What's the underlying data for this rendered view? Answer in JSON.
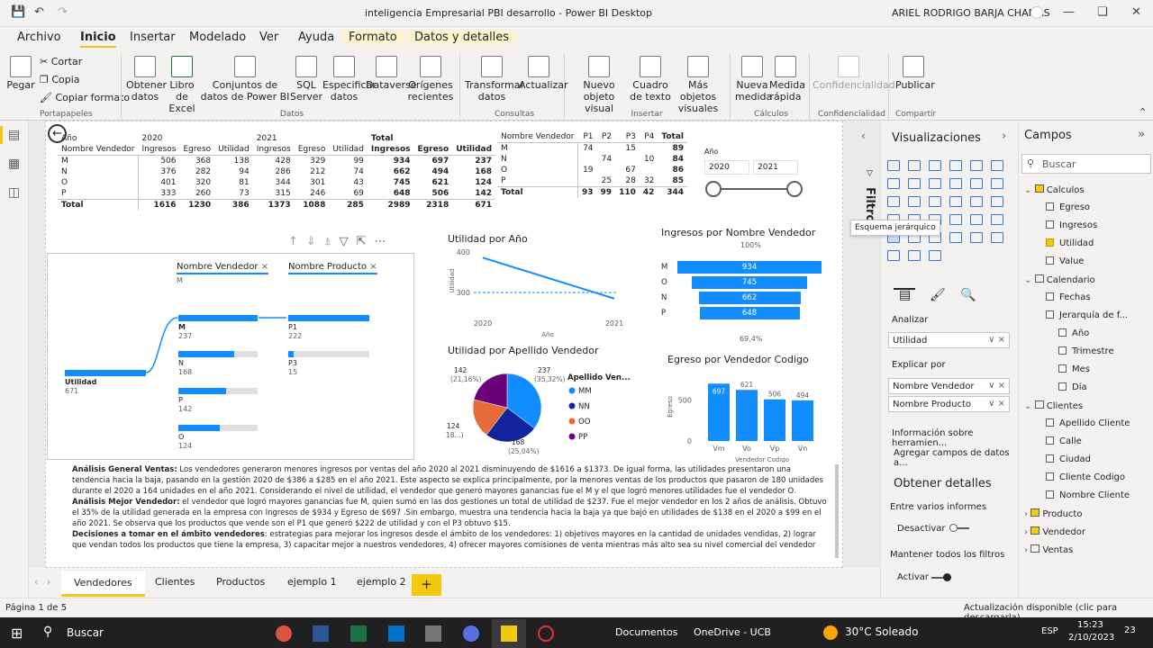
{
  "titlebar": {
    "title": "inteligencia Empresarial PBI desarrollo - Power BI Desktop",
    "user": "ARIEL RODRIGO BARJA CHAMAS"
  },
  "menu": [
    "Archivo",
    "Inicio",
    "Insertar",
    "Modelado",
    "Ver",
    "Ayuda",
    "Formato",
    "Datos y detalles"
  ],
  "ribbon": {
    "pegar": "Pegar",
    "cortar": "Cortar",
    "copia": "Copia",
    "copiar_formato": "Copiar formato",
    "obtener": "Obtener datos",
    "libro": "Libro de Excel",
    "conjuntos": "Conjuntos de datos de Power BI",
    "sql": "SQL Server",
    "especificar": "Especificar datos",
    "dataverse": "Dataverse",
    "origenes": "Orígenes recientes",
    "transformar": "Transformar datos",
    "actualizar": "Actualizar",
    "nuevo_visual": "Nuevo objeto visual",
    "cuadro_texto": "Cuadro de texto",
    "mas_objetos": "Más objetos visuales",
    "nueva_medida": "Nueva medida",
    "medida_rapida": "Medida rápida",
    "confidencialidad": "Confidencialidad",
    "publicar": "Publicar",
    "groups": {
      "portapapeles": "Portapapeles",
      "datos": "Datos",
      "consultas": "Consultas",
      "insertar": "Insertar",
      "calculos": "Cálculos",
      "confidencialidad": "Confidencialidad",
      "compartir": "Compartir"
    }
  },
  "table1": {
    "year_label": "Año",
    "vendor_header": "Nombre Vendedor",
    "y2020": "2020",
    "y2021": "2021",
    "total": "Total",
    "sub": [
      "Ingresos",
      "Egreso",
      "Utilidad",
      "Ingresos",
      "Egreso",
      "Utilidad",
      "Ingresos",
      "Egreso",
      "Utilidad"
    ],
    "rows": [
      [
        "M",
        "506",
        "368",
        "138",
        "428",
        "329",
        "99",
        "934",
        "697",
        "237"
      ],
      [
        "N",
        "376",
        "282",
        "94",
        "286",
        "212",
        "74",
        "662",
        "494",
        "168"
      ],
      [
        "O",
        "401",
        "320",
        "81",
        "344",
        "301",
        "43",
        "745",
        "621",
        "124"
      ],
      [
        "P",
        "333",
        "260",
        "73",
        "315",
        "246",
        "69",
        "648",
        "506",
        "142"
      ],
      [
        "Total",
        "1616",
        "1230",
        "386",
        "1373",
        "1088",
        "285",
        "2989",
        "2318",
        "671"
      ]
    ]
  },
  "table2": {
    "headers": [
      "Nombre Vendedor",
      "P1",
      "P2",
      "P3",
      "P4",
      "Total"
    ],
    "rows": [
      [
        "M",
        "74",
        "",
        "15",
        "",
        "89"
      ],
      [
        "N",
        "",
        "74",
        "",
        "10",
        "84"
      ],
      [
        "O",
        "19",
        "",
        "67",
        "",
        "86"
      ],
      [
        "P",
        "",
        "25",
        "28",
        "32",
        "85"
      ],
      [
        "Total",
        "93",
        "99",
        "110",
        "42",
        "344"
      ]
    ]
  },
  "slicer": {
    "label": "Año",
    "from": "2020",
    "to": "2021"
  },
  "decomp": {
    "chip1": "Nombre Vendedor",
    "chip2": "Nombre Producto",
    "chip1_sub": "M",
    "root_label": "Utilidad",
    "root_value": "671",
    "level1": [
      {
        "label": "M",
        "value": "237",
        "frac": 1
      },
      {
        "label": "N",
        "value": "168",
        "frac": 0.709
      },
      {
        "label": "P",
        "value": "142",
        "frac": 0.599
      },
      {
        "label": "O",
        "value": "124",
        "frac": 0.523
      }
    ],
    "level2": [
      {
        "label": "P1",
        "value": "222",
        "frac": 1
      },
      {
        "label": "P3",
        "value": "15",
        "frac": 0.068
      }
    ]
  },
  "line_chart": {
    "title": "Utilidad por Año",
    "ylabel": "Utilidad",
    "xlabel": "Año",
    "chart_data": {
      "type": "line",
      "x": [
        "2020",
        "2021"
      ],
      "y": [
        386,
        285
      ],
      "yticks": [
        "400",
        "300"
      ],
      "ylim": [
        280,
        400
      ]
    }
  },
  "pie_chart": {
    "title": "Utilidad por Apellido Vendedor",
    "legend_title": "Apellido Ven...",
    "chart_data": {
      "type": "pie",
      "labels": [
        "MM",
        "NN",
        "OO",
        "PP"
      ],
      "values": [
        237,
        168,
        124,
        142
      ],
      "colors": [
        "#118dff",
        "#12239e",
        "#e66c37",
        "#6b007b"
      ],
      "data_labels": [
        "237 (35,32%)",
        "168 (25,04%)",
        "124 (18...)",
        "142 (21,16%)"
      ]
    }
  },
  "funnel": {
    "title": "Ingresos por Nombre Vendedor",
    "top": "100%",
    "bottom": "69,4%",
    "chart_data": {
      "type": "bar",
      "categories": [
        "M",
        "O",
        "N",
        "P"
      ],
      "values": [
        934,
        745,
        662,
        648
      ]
    }
  },
  "column_chart": {
    "title": "Egreso por Vendedor Codigo",
    "ylabel": "Egreso",
    "xlabel": "Vendedor Codigo",
    "yticks": [
      "500",
      "0"
    ],
    "chart_data": {
      "type": "bar",
      "categories": [
        "Vm",
        "Vo",
        "Vp",
        "Vn"
      ],
      "values": [
        697,
        621,
        506,
        494
      ],
      "ylim": [
        0,
        700
      ]
    }
  },
  "analysis": {
    "p1_title": "Análisis General Ventas:",
    "p1": " Los vendedores generaron menores ingresos por ventas del año 2020 al 2021 disminuyendo de $1616 a $1373. De igual forma, las utilidades presentaron una tendencia hacia la baja, pasando en la gestión 2020 de $386 a $285 en el año 2021. Este aspecto se explica principalmente, por la menores ventas de los productos que pasaron de 180 unidades durante el 2020 a 164 unidades en el año 2021. Considerando el nivel de utilidad, el vendedor que generó mayores ganancias fue el M y el que logró menores utilidades fue el vendedor O.",
    "p2_title": "Análisis Mejor Vendedor:",
    "p2": " el vendedor que logró mayores ganancias fue M, quien sumó en las dos gestiones un total de utilidad de $237. Fue el mejor vendedor en los 2 años de análisis. Obtuvo el 35% de la utilidad generada en la empresa con Ingresos de $934 y Egreso de $697 .Sin embargo, muestra una tendencia hacia la baja ya que bajó en utilidades de $138 en el 2020 a $99 en el año 2021. Se observa que los productos que vende son el P1 que generó $222 de utilidad y con el P3 obtuvo $15.",
    "p3_title": "Decisiones a tomar en el ámbito vendedores",
    "p3": ": estrategias para mejorar los ingresos desde el ámbito de los vendedores: 1) objetivos mayores en la cantidad de unidades vendidas, 2) lograr que vendan todos los productos que tiene la empresa, 3) capacitar mejor a nuestros vendedores, 4) ofrecer mayores comisiones de venta mientras más alto sea su nivel comercial del vendedor"
  },
  "pages": [
    "Vendedores",
    "Clientes",
    "Productos",
    "ejemplo 1",
    "ejemplo 2",
    "+"
  ],
  "status": {
    "page": "Página 1 de 5",
    "update": "Actualización disponible (clic para descargarla)"
  },
  "filters_label": "Filtros",
  "vis": {
    "title": "Visualizaciones",
    "tooltip": "Esquema jerárquico",
    "analizar": "Analizar",
    "analizar_val": "Utilidad",
    "explicar": "Explicar por",
    "explicar_vals": [
      "Nombre Vendedor",
      "Nombre Producto"
    ],
    "info": "Información sobre herramien...",
    "agregar": "Agregar campos de datos a...",
    "obtener": "Obtener detalles",
    "entre": "Entre varios informes",
    "desactivar": "Desactivar",
    "mantener": "Mantener todos los filtros",
    "activar": "Activar"
  },
  "campos": {
    "title": "Campos",
    "search": "Buscar",
    "items": [
      {
        "t": "Calculos",
        "lvl": 0,
        "kind": "table"
      },
      {
        "t": "Egreso",
        "lvl": 1,
        "kind": "field",
        "on": false
      },
      {
        "t": "Ingresos",
        "lvl": 1,
        "kind": "field",
        "on": false
      },
      {
        "t": "Utilidad",
        "lvl": 1,
        "kind": "field",
        "on": true
      },
      {
        "t": "Value",
        "lvl": 1,
        "kind": "field",
        "on": false
      },
      {
        "t": "Calendario",
        "lvl": 0,
        "kind": "table"
      },
      {
        "t": "Fechas",
        "lvl": 1,
        "kind": "field",
        "on": false
      },
      {
        "t": "Jerarquía de f...",
        "lvl": 2,
        "kind": "field",
        "on": false
      },
      {
        "t": "Año",
        "lvl": 3,
        "kind": "field",
        "on": false
      },
      {
        "t": "Trimestre",
        "lvl": 3,
        "kind": "field",
        "on": false
      },
      {
        "t": "Mes",
        "lvl": 3,
        "kind": "field",
        "on": false
      },
      {
        "t": "Día",
        "lvl": 3,
        "kind": "field",
        "on": false
      },
      {
        "t": "Clientes",
        "lvl": 0,
        "kind": "table"
      },
      {
        "t": "Apellido Cliente",
        "lvl": 1,
        "kind": "field",
        "on": false
      },
      {
        "t": "Calle",
        "lvl": 1,
        "kind": "field",
        "on": false
      },
      {
        "t": "Ciudad",
        "lvl": 1,
        "kind": "field",
        "on": false
      },
      {
        "t": "Cliente Codigo",
        "lvl": 1,
        "kind": "field",
        "on": false
      },
      {
        "t": "Nombre Cliente",
        "lvl": 1,
        "kind": "field",
        "on": false
      },
      {
        "t": "Producto",
        "lvl": 0,
        "kind": "table"
      },
      {
        "t": "Vendedor",
        "lvl": 0,
        "kind": "table"
      },
      {
        "t": "Ventas",
        "lvl": 0,
        "kind": "table"
      }
    ]
  },
  "taskbar": {
    "search": "Buscar",
    "documentos": "Documentos",
    "onedrive": "OneDrive - UCB",
    "weather": "30°C Soleado",
    "lang": "ESP",
    "time": "15:23",
    "date": "2/10/2023",
    "notif": "23"
  }
}
